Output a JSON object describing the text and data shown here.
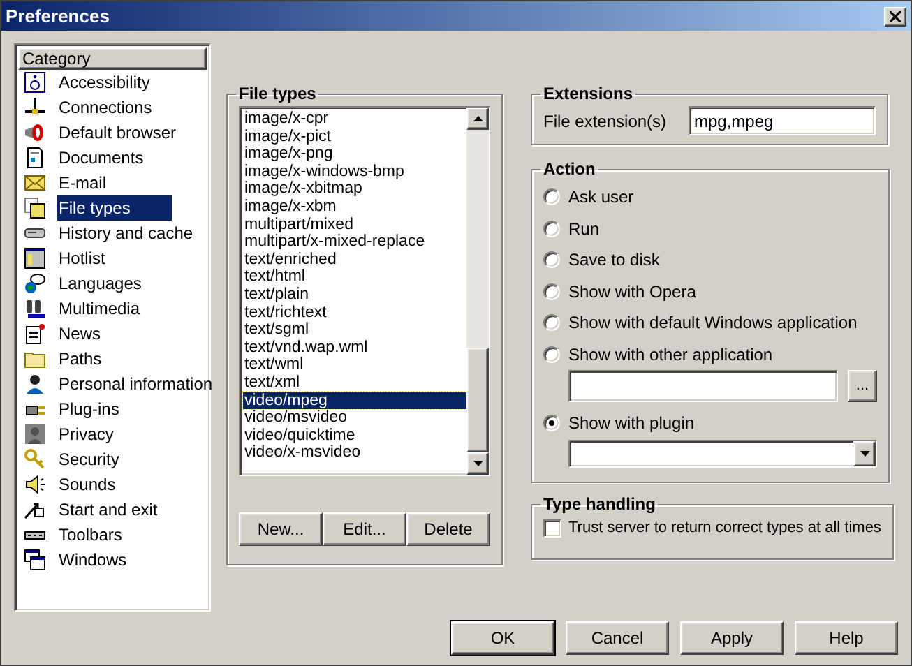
{
  "window": {
    "title": "Preferences"
  },
  "category": {
    "header": "Category",
    "items": [
      {
        "label": "Accessibility",
        "selected": false
      },
      {
        "label": "Connections",
        "selected": false
      },
      {
        "label": "Default browser",
        "selected": false
      },
      {
        "label": "Documents",
        "selected": false
      },
      {
        "label": "E-mail",
        "selected": false
      },
      {
        "label": "File types",
        "selected": true
      },
      {
        "label": "History and cache",
        "selected": false
      },
      {
        "label": "Hotlist",
        "selected": false
      },
      {
        "label": "Languages",
        "selected": false
      },
      {
        "label": "Multimedia",
        "selected": false
      },
      {
        "label": "News",
        "selected": false
      },
      {
        "label": "Paths",
        "selected": false
      },
      {
        "label": "Personal information",
        "selected": false
      },
      {
        "label": "Plug-ins",
        "selected": false
      },
      {
        "label": "Privacy",
        "selected": false
      },
      {
        "label": "Security",
        "selected": false
      },
      {
        "label": "Sounds",
        "selected": false
      },
      {
        "label": "Start and exit",
        "selected": false
      },
      {
        "label": "Toolbars",
        "selected": false
      },
      {
        "label": "Windows",
        "selected": false
      }
    ]
  },
  "file_types": {
    "title": "File types",
    "items": [
      {
        "label": "image/x-cpr",
        "selected": false
      },
      {
        "label": "image/x-pict",
        "selected": false
      },
      {
        "label": "image/x-png",
        "selected": false
      },
      {
        "label": "image/x-windows-bmp",
        "selected": false
      },
      {
        "label": "image/x-xbitmap",
        "selected": false
      },
      {
        "label": "image/x-xbm",
        "selected": false
      },
      {
        "label": "multipart/mixed",
        "selected": false
      },
      {
        "label": "multipart/x-mixed-replace",
        "selected": false
      },
      {
        "label": "text/enriched",
        "selected": false
      },
      {
        "label": "text/html",
        "selected": false
      },
      {
        "label": "text/plain",
        "selected": false
      },
      {
        "label": "text/richtext",
        "selected": false
      },
      {
        "label": "text/sgml",
        "selected": false
      },
      {
        "label": "text/vnd.wap.wml",
        "selected": false
      },
      {
        "label": "text/wml",
        "selected": false
      },
      {
        "label": "text/xml",
        "selected": false
      },
      {
        "label": "video/mpeg",
        "selected": true
      },
      {
        "label": "video/msvideo",
        "selected": false
      },
      {
        "label": "video/quicktime",
        "selected": false
      },
      {
        "label": "video/x-msvideo",
        "selected": false
      }
    ],
    "buttons": [
      "New...",
      "Edit...",
      "Delete"
    ]
  },
  "extensions": {
    "title": "Extensions",
    "label": "File extension(s)",
    "value": "mpg,mpeg"
  },
  "action": {
    "title": "Action",
    "options": [
      {
        "label": "Ask user",
        "selected": false
      },
      {
        "label": "Run",
        "selected": false
      },
      {
        "label": "Save to disk",
        "selected": false
      },
      {
        "label": "Show with Opera",
        "selected": false
      },
      {
        "label": "Show with default Windows application",
        "selected": false
      },
      {
        "label": "Show with other application",
        "selected": false,
        "kind": "file"
      },
      {
        "label": "Show with plugin",
        "selected": true,
        "kind": "dropdown"
      }
    ],
    "browse_button": "..."
  },
  "type_handling": {
    "title": "Type handling",
    "checkbox": {
      "label": "Trust server to return correct types at all times",
      "checked": false
    }
  },
  "buttons": [
    "OK",
    "Cancel",
    "Apply",
    "Help"
  ]
}
